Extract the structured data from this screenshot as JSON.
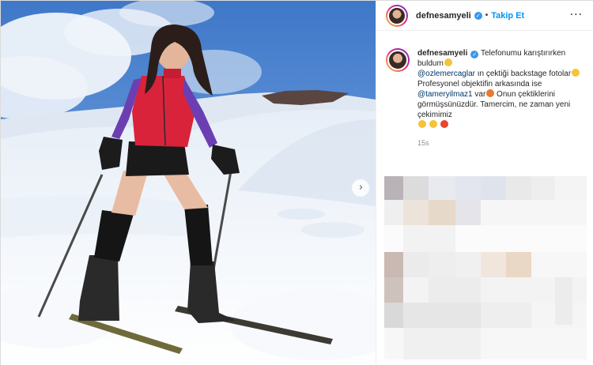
{
  "post": {
    "username": "defnesamyeli",
    "follow_label": "Takip Et",
    "separator": "•",
    "more_label": "···",
    "caption": {
      "username": "defnesamyeli",
      "text1": " Telefonumu karıştırırken buldum",
      "mention1": "@ozlemercaglar",
      "text2": " ın çektiği backstage fotolar",
      "text3": " Profesyonel objektifin arkasında ise ",
      "mention2": "@tameryilmaz1",
      "text4": " var",
      "text5": " Onun çektiklerini görmüşsünüzdür. Tamercim, ne zaman yeni çekimimiz"
    },
    "time": "15s"
  },
  "media": {
    "next_icon": "chevron-right-icon",
    "next_symbol": "›"
  },
  "colors": {
    "link": "#00376b",
    "follow": "#0095f6",
    "verified": "#3897f0",
    "sky": "#5a8fd6"
  }
}
